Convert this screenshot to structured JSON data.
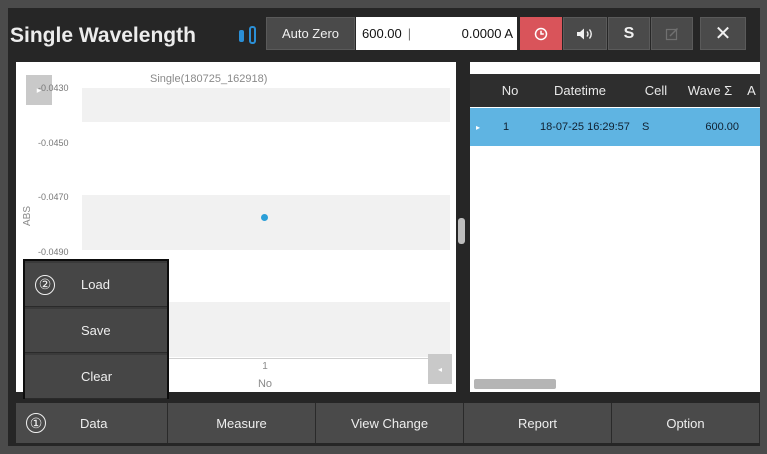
{
  "header": {
    "title": "Single Wavelength",
    "auto_zero_label": "Auto Zero",
    "wavelength_value": "600.00",
    "abs_value": "0.0000 A",
    "s_label": "S",
    "close_label": "✕",
    "icons": [
      "usb-icon",
      "timer-icon",
      "sound-icon",
      "edit-icon",
      "close-icon"
    ]
  },
  "chart": {
    "title": "Single(180725_162918)",
    "expand_glyph": "▸",
    "scroll_glyph": "◂",
    "y_ticks": [
      "-0.0430",
      "-0.0450",
      "-0.0470",
      "-0.0490"
    ],
    "y_label": "ABS",
    "x_tick": "1",
    "x_label": "No"
  },
  "chart_data": {
    "type": "scatter",
    "title": "Single(180725_162918)",
    "xlabel": "No",
    "ylabel": "ABS",
    "x": [
      1
    ],
    "y": [
      -0.0476
    ],
    "y_ticks": [
      -0.043,
      -0.045,
      -0.047,
      -0.049
    ],
    "x_ticks": [
      1
    ],
    "grid": true,
    "point_color": "#2b9fd8"
  },
  "grid": {
    "columns": [
      "No",
      "Datetime",
      "Cell",
      "Wave Σ",
      "A"
    ],
    "rows": [
      {
        "marker": "▸",
        "no": "1",
        "datetime": "18-07-25 16:29:57",
        "cell": "S",
        "wave": "600.00",
        "extra": ""
      }
    ],
    "selected_row_color": "#5fb4e2"
  },
  "menu": {
    "badge": "②",
    "items": [
      "Load",
      "Save",
      "Clear"
    ]
  },
  "bottom_bar": {
    "badge": "①",
    "tabs": [
      "Data",
      "Measure",
      "View Change",
      "Report",
      "Option"
    ]
  },
  "colors": {
    "background": "#262626",
    "timer_button": "#d9545a",
    "accent_blue": "#2b9fd8"
  }
}
